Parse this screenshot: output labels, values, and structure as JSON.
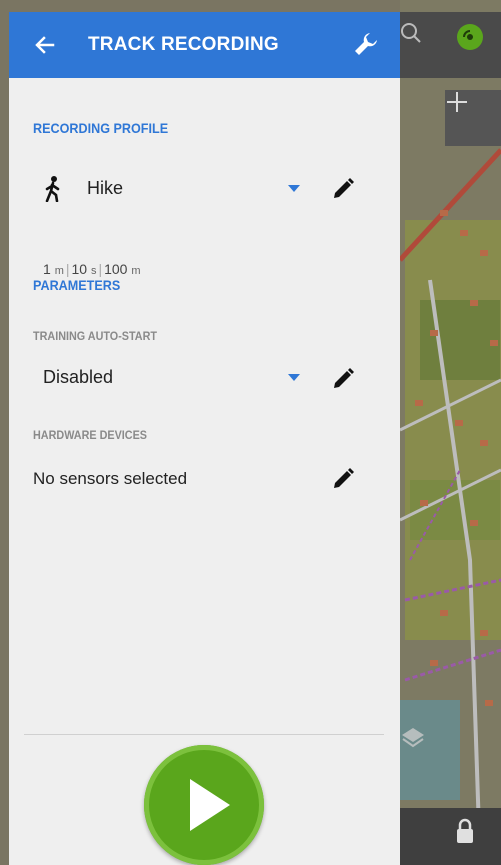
{
  "header": {
    "title": "TRACK RECORDING",
    "back_icon": "arrow-left-icon",
    "settings_icon": "wrench-icon"
  },
  "recording_profile": {
    "section_title": "RECORDING PROFILE",
    "profile_icon": "hiker-icon",
    "profile_name": "Hike",
    "stats": [
      {
        "value": "1",
        "unit": "m"
      },
      {
        "value": "10",
        "unit": "s"
      },
      {
        "value": "100",
        "unit": "m"
      }
    ]
  },
  "parameters": {
    "section_title": "PARAMETERS",
    "training_autostart": {
      "label": "TRAINING AUTO-START",
      "value": "Disabled"
    },
    "hardware_devices": {
      "label": "HARDWARE DEVICES",
      "value": "No sensors selected"
    }
  },
  "actions": {
    "start_icon": "play-icon"
  },
  "colors": {
    "accent": "#2f77d6",
    "play": "#5aa61c",
    "drawer_bg": "#efefef"
  }
}
